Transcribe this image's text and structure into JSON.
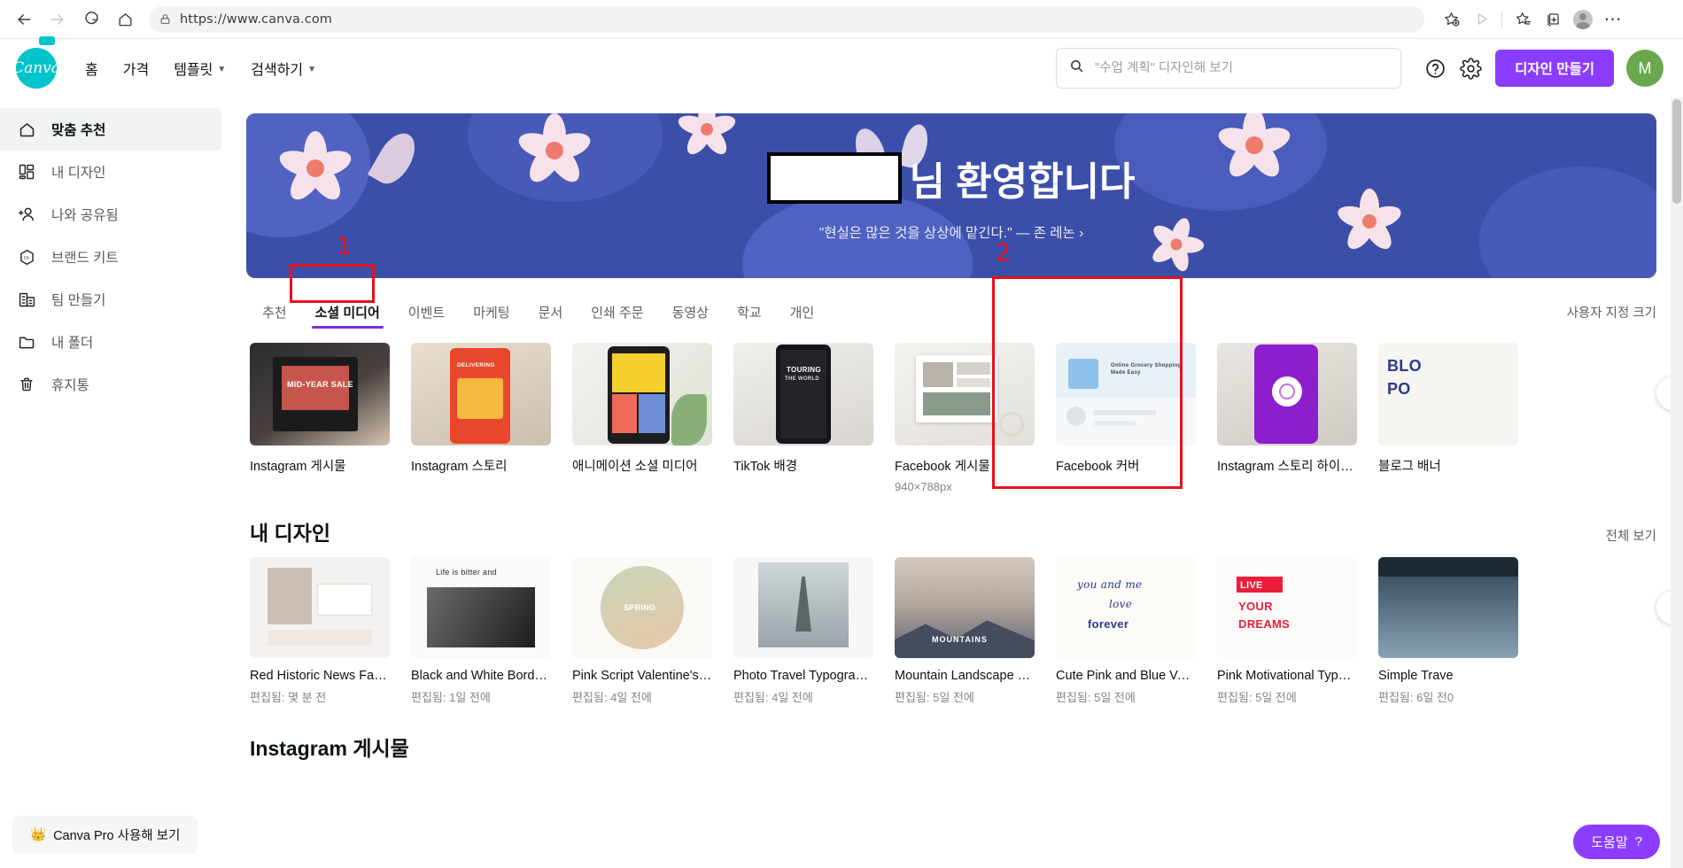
{
  "browser": {
    "url": "https://www.canva.com",
    "back_icon": "back-arrow-icon",
    "forward_icon": "forward-arrow-icon",
    "reload_icon": "reload-icon",
    "home_icon": "home-icon",
    "lock_icon": "lock-icon"
  },
  "header": {
    "logo_text": "Canva",
    "nav": [
      {
        "label": "홈",
        "caret": false
      },
      {
        "label": "가격",
        "caret": false
      },
      {
        "label": "템플릿",
        "caret": true
      },
      {
        "label": "검색하기",
        "caret": true
      }
    ],
    "search_placeholder": "\"수업 계획\" 디자인해 보기",
    "help_icon": "question-circle-icon",
    "settings_icon": "gear-icon",
    "cta_label": "디자인 만들기",
    "avatar_initial": "M",
    "accent_purple": "#8b3dff",
    "brand_teal": "#00c4cc"
  },
  "sidebar": {
    "items": [
      {
        "label": "맞춤 추천",
        "icon": "home-icon",
        "active": true
      },
      {
        "label": "내 디자인",
        "icon": "grid-icon",
        "active": false
      },
      {
        "label": "나와 공유됨",
        "icon": "add-person-icon",
        "active": false
      },
      {
        "label": "브랜드 키트",
        "icon": "brand-hex-icon",
        "active": false
      },
      {
        "label": "팀 만들기",
        "icon": "building-icon",
        "active": false
      },
      {
        "label": "내 폴더",
        "icon": "folder-icon",
        "active": false
      },
      {
        "label": "휴지통",
        "icon": "trash-icon",
        "active": false
      }
    ],
    "pro_label": "Canva Pro 사용해 보기",
    "pro_icon": "crown-icon"
  },
  "banner": {
    "name_redacted": "",
    "welcome_suffix": "님 환영합니다",
    "quote": "\"현실은 많은 것을 상상에 맡긴다.\" — 존 레논 ›",
    "background_color": "#3c4fa8"
  },
  "tabs": {
    "items": [
      {
        "label": "추천",
        "active": false
      },
      {
        "label": "소셜 미디어",
        "active": true
      },
      {
        "label": "이벤트",
        "active": false
      },
      {
        "label": "마케팅",
        "active": false
      },
      {
        "label": "문서",
        "active": false
      },
      {
        "label": "인쇄 주문",
        "active": false
      },
      {
        "label": "동영상",
        "active": false
      },
      {
        "label": "학교",
        "active": false
      },
      {
        "label": "개인",
        "active": false
      }
    ],
    "custom_size_label": "사용자 지정 크기"
  },
  "templates": {
    "cards": [
      {
        "label": "Instagram 게시물",
        "sub": ""
      },
      {
        "label": "Instagram 스토리",
        "sub": ""
      },
      {
        "label": "애니메이션 소셜 미디어",
        "sub": ""
      },
      {
        "label": "TikTok 배경",
        "sub": ""
      },
      {
        "label": "Facebook 게시물",
        "sub": "940×788px"
      },
      {
        "label": "Facebook 커버",
        "sub": ""
      },
      {
        "label": "Instagram 스토리 하이라이...",
        "sub": ""
      },
      {
        "label": "블로그 배너",
        "sub": ""
      }
    ],
    "next_icon": "chevron-right-icon"
  },
  "my_designs": {
    "title": "내 디자인",
    "view_all_label": "전체 보기",
    "cards": [
      {
        "label": "Red Historic News Facebo...",
        "sub": "편집됨: 몇 분 전"
      },
      {
        "label": "Black and White Bordered ...",
        "sub": "편집됨: 1일 전에"
      },
      {
        "label": "Pink Script Valentine's Day...",
        "sub": "편집됨: 4일 전에"
      },
      {
        "label": "Photo Travel Typography T...",
        "sub": "편집됨: 4일 전에"
      },
      {
        "label": "Mountain Landscape Phot...",
        "sub": "편집됨: 5일 전에"
      },
      {
        "label": "Cute Pink and Blue Valenti...",
        "sub": "편집됨: 5일 전에"
      },
      {
        "label": "Pink Motivational Typogra...",
        "sub": "편집됨: 5일 전에"
      },
      {
        "label": "Simple Trave",
        "sub": "편집됨: 6일 전0"
      }
    ],
    "next_icon": "chevron-right-icon"
  },
  "instagram_section": {
    "title": "Instagram 게시물"
  },
  "annotations": {
    "one": "1",
    "two": "2",
    "color": "#e8101b"
  },
  "help": {
    "label": "도움말",
    "icon": "question-mark-icon"
  },
  "thumb_text": {
    "t1": "MID-YEAR SALE",
    "t2": "DELIVERING",
    "t4a": "TOURING",
    "t4b": "THE WORLD",
    "t6": "Online Grocery Shopping Made Easy",
    "t8a": "BLO",
    "t8b": "PO",
    "d2": "Life is bitter and",
    "d3": "SPRING",
    "d5": "MOUNTAINS",
    "d6a": "you and me",
    "d6b": "love",
    "d6c": "forever",
    "d7a": "LIVE",
    "d7b": "YOUR",
    "d7c": "DREAMS"
  }
}
